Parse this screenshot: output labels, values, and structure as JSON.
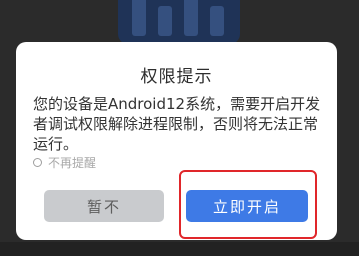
{
  "dialog": {
    "title": "权限提示",
    "message": "您的设备是Android12系统，需要开启开发者调试权限解除进程限制，否则将无法正常运行。",
    "dont_remind_label": "不再提醒",
    "cancel_label": "暂不",
    "confirm_label": "立即开启"
  },
  "colors": {
    "confirm_button": "#3e7ae6",
    "cancel_button": "#c9cbce",
    "highlight_box": "#e0262a",
    "dimmed_background": "#2b2b2b"
  },
  "icons": {
    "app_logo": "app-logo-icon",
    "radio": "radio-circle-icon"
  }
}
